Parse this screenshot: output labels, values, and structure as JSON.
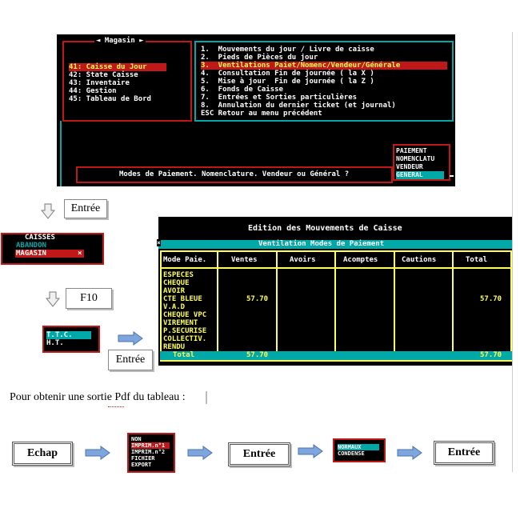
{
  "main_screen": {
    "top_left_fragment": "",
    "top_right_fragment": "",
    "magasin_title": "◄ Magasin ►",
    "left_menu": [
      "41: Caisse du Jour",
      "42: State Caisse",
      "43: Inventaire",
      "44: Gestion",
      "45: Tableau de Bord"
    ],
    "right_menu": [
      "1.  Mouvements du jour / Livre de caisse",
      "2.  Pieds de Pièces du jour",
      "3.  Ventilations Paiet/Nomenc/Vendeur/Générale",
      "4.  Consultation Fin de journée ( la X )",
      "5.  Mise à jour  Fin de journée ( la Z )",
      "6.  Fonds de Caisse",
      "7.  Entrées et Sorties particulières",
      "8.  Annulation du dernier ticket (et journal)",
      "ESC Retour au menu précédent"
    ],
    "prompt": "Modes de Paiement. Nomenclature. Vendeur ou Général ?",
    "options": [
      "PAIEMENT",
      "NOMENCLATU",
      "VENDEUR",
      "GENERAL"
    ]
  },
  "keys": {
    "entree": "Entrée",
    "f10": "F10",
    "echap": "Echap"
  },
  "caisses_popup": {
    "title": "CAISSES",
    "items": [
      "ABANDON",
      "MAGASIN"
    ],
    "close": "×"
  },
  "tva_popup": {
    "items": [
      "T.T.C.",
      "H.T."
    ]
  },
  "edition": {
    "title": "Edition des Mouvements de Caisse",
    "subtitle": "Ventilation Modes de Paiement",
    "headers": [
      "Mode Paie.",
      "Ventes",
      "Avoirs",
      "Acomptes",
      "Cautions",
      "Total"
    ],
    "modes": [
      "ESPECES",
      "CHEQUE",
      "AVOIR",
      "CTE BLEUE",
      "V.A.D",
      "CHEQUE VPC",
      "VIREMENT",
      "P.SECURISE",
      "COLLECTIV.",
      "RENDU"
    ],
    "cb_ventes": "57.70",
    "cb_total": "57.70",
    "total_label": "Total",
    "total_ventes": "57.70",
    "total_total": "57.70"
  },
  "instruction": "Pour obtenir une sortie Pdf du tableau :",
  "print_menu": {
    "items": [
      "NON",
      "IMPRIM.n°1",
      "IMPRIM.n°2",
      "FICHIER",
      "EXPORT"
    ]
  },
  "format_menu": {
    "items": [
      "NORMAUX",
      "CONDENSE"
    ]
  },
  "colors": {
    "terminal_bg": "#000000",
    "accent_cyan": "#00a8a8",
    "highlight_red": "#c01818",
    "yellow": "#ffff55",
    "white": "#ffffff"
  }
}
